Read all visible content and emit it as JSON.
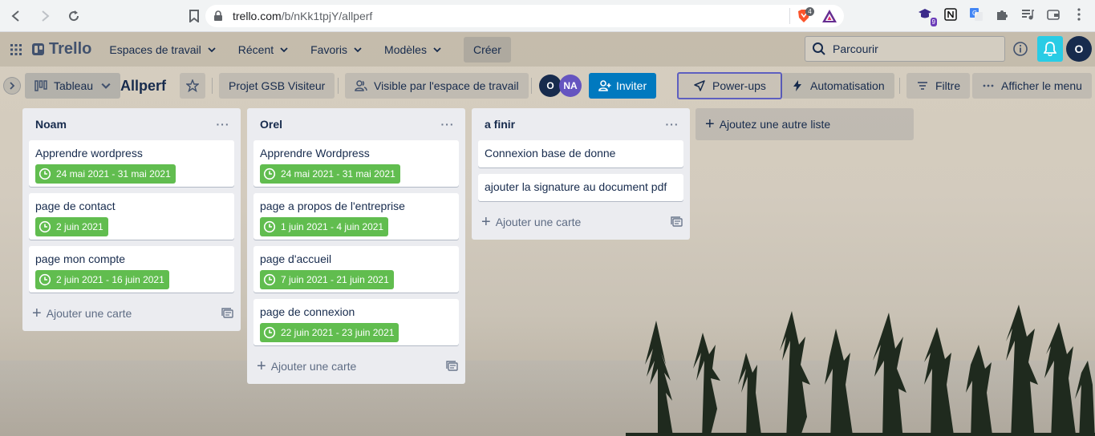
{
  "browser": {
    "url_domain": "trello.com",
    "url_path": "/b/nKk1tpjY/allperf",
    "brave_shield_count": "4",
    "ext_badge": "9"
  },
  "header": {
    "logo_text": "Trello",
    "nav": [
      {
        "label": "Espaces de travail"
      },
      {
        "label": "Récent"
      },
      {
        "label": "Favoris"
      },
      {
        "label": "Modèles"
      }
    ],
    "create_label": "Créer",
    "search_placeholder": "Parcourir",
    "user_initial": "O",
    "accent_color": "#29cce5"
  },
  "board": {
    "view_label": "Tableau",
    "title": "Allperf",
    "workspace_label": "Projet GSB Visiteur",
    "visibility_label": "Visible par l'espace de travail",
    "members": [
      {
        "initials": "O",
        "color": "#172b4d"
      },
      {
        "initials": "NA",
        "color": "#6554c0"
      }
    ],
    "invite_label": "Inviter",
    "powerups_label": "Power-ups",
    "automation_label": "Automatisation",
    "filter_label": "Filtre",
    "menu_label": "Afficher le menu",
    "invite_color": "#0079bf",
    "badge_color": "#61bd4f"
  },
  "lists": [
    {
      "title": "Noam",
      "menu": "···",
      "cards": [
        {
          "title": "Apprendre wordpress",
          "date": "24 mai 2021 - 31 mai 2021"
        },
        {
          "title": "page de contact",
          "date": "2 juin 2021"
        },
        {
          "title": "page mon compte",
          "date": "2 juin 2021 - 16 juin 2021"
        }
      ],
      "add_card": "Ajouter une carte"
    },
    {
      "title": "Orel",
      "menu": "···",
      "cards": [
        {
          "title": "Apprendre Wordpress",
          "date": "24 mai 2021 - 31 mai 2021"
        },
        {
          "title": "page a propos de l'entreprise",
          "date": "1 juin 2021 - 4 juin 2021"
        },
        {
          "title": "page d'accueil",
          "date": "7 juin 2021 - 21 juin 2021"
        },
        {
          "title": "page de connexion",
          "date": "22 juin 2021 - 23 juin 2021"
        }
      ],
      "add_card": "Ajouter une carte"
    },
    {
      "title": "a finir",
      "menu": "···",
      "cards": [
        {
          "title": "Connexion base de donne"
        },
        {
          "title": "ajouter la signature au document pdf"
        }
      ],
      "add_card": "Ajouter une carte"
    }
  ],
  "add_list_label": "Ajoutez une autre liste"
}
